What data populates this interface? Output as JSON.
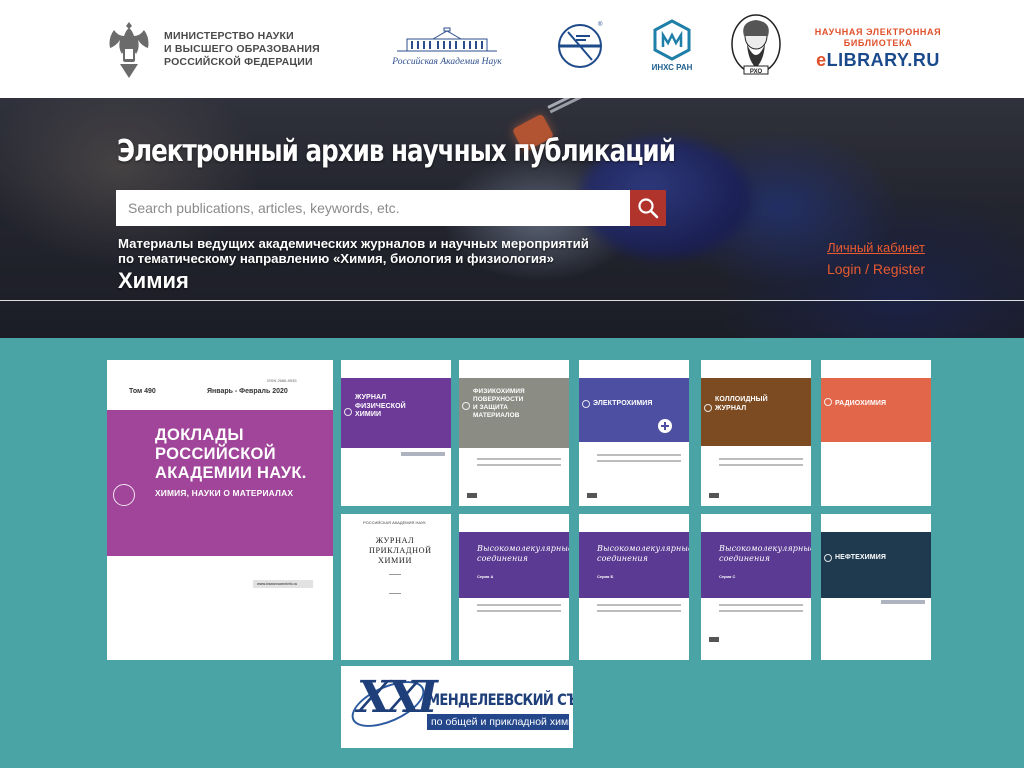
{
  "header": {
    "ministry": {
      "lines": [
        "МИНИСТЕРСТВО НАУКИ",
        "И ВЫСШЕГО ОБРАЗОВАНИЯ",
        "РОССИЙСКОЙ ФЕДЕРАЦИИ"
      ]
    },
    "ras": {
      "caption": "Российская Академия Наук"
    },
    "inhs": {
      "caption": "ИНХС РАН"
    },
    "rho": {
      "caption": "РХО"
    },
    "elibrary": {
      "small_line1": "НАУЧНАЯ ЭЛЕКТРОННАЯ",
      "small_line2": "БИБЛИОТЕКА",
      "name_prefix": "e",
      "name_rest": "LIBRARY.RU"
    }
  },
  "hero": {
    "title": "Электронный архив научных публикаций",
    "search": {
      "placeholder": "Search publications, articles, keywords, etc.",
      "value": ""
    },
    "description_line1": "Материалы ведущих академических журналов и научных мероприятий",
    "description_line2": "по тематическому направлению  «Химия, биология и физиология»",
    "section": "Химия",
    "account": {
      "label": "Личный кабинет",
      "login": "Login / Register"
    }
  },
  "journals": [
    {
      "id": "dan",
      "volume": "Том 490",
      "issue_date": "Январь - Февраль 2020",
      "issn": "ISSN 2686-9535",
      "title_lines": [
        "ДОКЛАДЫ",
        "РОССИЙСКОЙ",
        "АКАДЕМИИ НАУК."
      ],
      "subtitle": "ХИМИЯ, НАУКИ О МАТЕРИАЛАХ",
      "website": "www.ivanovsomeinfo.ru",
      "color": "#a0459a"
    },
    {
      "id": "zhfh",
      "title_lines": [
        "ЖУРНАЛ",
        "ФИЗИЧЕСКОЙ",
        "ХИМИИ"
      ],
      "color": "#6d3a98"
    },
    {
      "id": "fpzm",
      "title_lines": [
        "ФИЗИКОХИМИЯ",
        "ПОВЕРХНОСТИ",
        "И ЗАЩИТА",
        "МАТЕРИАЛОВ"
      ],
      "color": "#8b8d85"
    },
    {
      "id": "electrochem",
      "title_lines": [
        "ЭЛЕКТРОХИМИЯ"
      ],
      "color": "#4c4fa2"
    },
    {
      "id": "colloid",
      "title_lines": [
        "КОЛЛОИДНЫЙ",
        "ЖУРНАЛ"
      ],
      "color": "#7c4b22"
    },
    {
      "id": "radiochem",
      "title_lines": [
        "РАДИОХИМИЯ"
      ],
      "color": "#e2664a"
    },
    {
      "id": "zhpch",
      "publisher": "РОССИЙСКАЯ АКАДЕМИЯ НАУК",
      "title_lines": [
        "ЖУРНАЛ",
        "ПРИКЛАДНОЙ",
        "ХИМИИ"
      ],
      "color": "#ffffff"
    },
    {
      "id": "vms-a",
      "title_lines": [
        "Высокомолекулярные",
        "соединения"
      ],
      "series": "Серия А",
      "color": "#5a3a92"
    },
    {
      "id": "vms-b",
      "title_lines": [
        "Высокомолекулярные",
        "соединения"
      ],
      "series": "Серия Б",
      "color": "#5a3a92"
    },
    {
      "id": "vms-c",
      "title_lines": [
        "Высокомолекулярные",
        "соединения"
      ],
      "series": "Серия С",
      "color": "#5a3a92"
    },
    {
      "id": "neftekhim",
      "title_lines": [
        "НЕФТЕХИМИЯ"
      ],
      "color": "#1f3a4e"
    }
  ],
  "mendeleev": {
    "roman": "XXI",
    "title": "МЕНДЕЛЕЕВСКИЙ СЪЕЗД",
    "subtitle": "по общей и прикладной химии"
  },
  "colors": {
    "teal": "#4aa3a4",
    "search_button": "#b0332c",
    "account_link": "#e85a30"
  }
}
